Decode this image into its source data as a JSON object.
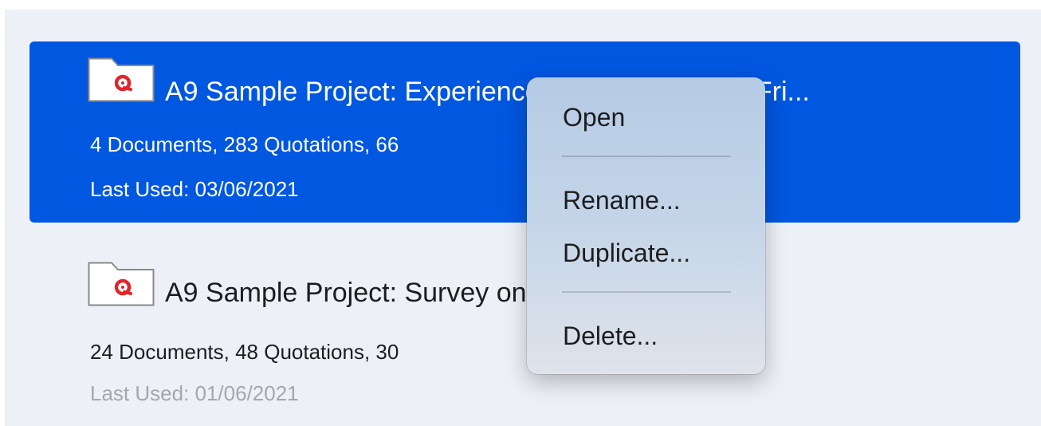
{
  "projects": [
    {
      "title": "A9 Sample Project: Experiences and Meaning of Fri...",
      "stats": "4 Documents, 283 Quotations, 66",
      "last_used": "Last Used: 03/06/2021",
      "selected": true
    },
    {
      "title": "A9 Sample Project: Survey on Happiness",
      "stats": "24 Documents, 48 Quotations, 30",
      "last_used": "Last Used: 01/06/2021",
      "selected": false
    }
  ],
  "context_menu": {
    "open": "Open",
    "rename": "Rename...",
    "duplicate": "Duplicate...",
    "delete": "Delete..."
  },
  "colors": {
    "selection": "#0057e0",
    "background": "#edf0f7",
    "icon_red": "#e0262b"
  },
  "icons": {
    "project": "atlasti-project-folder-icon"
  }
}
